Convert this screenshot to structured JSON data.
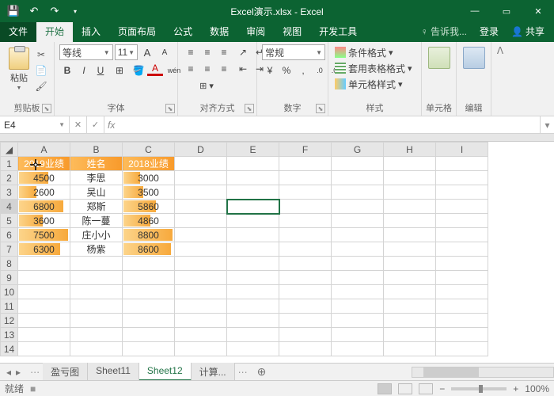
{
  "title": "Excel演示.xlsx - Excel",
  "qat": {
    "save": "💾",
    "undo": "↶",
    "redo": "↷",
    "more": "▾"
  },
  "win": {
    "min": "—",
    "max": "▭",
    "close": "✕"
  },
  "tabs": {
    "file": "文件",
    "home": "开始",
    "insert": "插入",
    "layout": "页面布局",
    "formulas": "公式",
    "data": "数据",
    "review": "审阅",
    "view": "视图",
    "dev": "开发工具"
  },
  "tellme": "♀ 告诉我...",
  "login": "登录",
  "share": "共享",
  "share_icon": "👤",
  "ribbon": {
    "clipboard": {
      "label": "剪贴板",
      "paste": "粘贴",
      "cut": "✂",
      "copy": "📄",
      "painter": "🖌"
    },
    "font": {
      "label": "字体",
      "name": "等线",
      "size": "11",
      "inc": "A",
      "dec": "A",
      "b": "B",
      "i": "I",
      "u": "U",
      "border": "⊞",
      "fill": "🪣",
      "color": "A",
      "phon": "wén"
    },
    "align": {
      "label": "对齐方式"
    },
    "number": {
      "label": "数字",
      "cat": "常规",
      "cur": "¥",
      "pct": "%",
      "comma": ",",
      "inc": ".0",
      "dec": ".00"
    },
    "styles": {
      "label": "样式",
      "cond": "条件格式",
      "table": "套用表格格式",
      "cell": "单元格样式"
    },
    "cells": {
      "label": "单元格"
    },
    "editing": {
      "label": "编辑"
    },
    "collapse": "ᐱ"
  },
  "namebox": "E4",
  "fx": "fx",
  "sheet": {
    "cols": [
      "A",
      "B",
      "C",
      "D",
      "E",
      "F",
      "G",
      "H",
      "I"
    ],
    "headers": {
      "a": "2019业绩",
      "b": "姓名",
      "c": "2018业绩"
    },
    "rows": [
      {
        "a": "4500",
        "aw": 60,
        "b": "李思",
        "c": "3000",
        "cw": 34
      },
      {
        "a": "2600",
        "aw": 35,
        "b": "吴山",
        "c": "3500",
        "cw": 40
      },
      {
        "a": "6800",
        "aw": 90,
        "b": "郑斯",
        "c": "5860",
        "cw": 66
      },
      {
        "a": "3600",
        "aw": 48,
        "b": "陈一蔓",
        "c": "4860",
        "cw": 55
      },
      {
        "a": "7500",
        "aw": 100,
        "b": "庄小小",
        "c": "8800",
        "cw": 100
      },
      {
        "a": "6300",
        "aw": 84,
        "b": "杨紫",
        "c": "8600",
        "cw": 97
      }
    ]
  },
  "sheettabs": {
    "nav": [
      "◂",
      "▸"
    ],
    "tabs": [
      "盈亏图",
      "Sheet11",
      "Sheet12",
      "计算..."
    ],
    "active": 2,
    "add": "⊕",
    "more": "⋯"
  },
  "status": {
    "ready": "就绪",
    "rec": "■",
    "zoom": "100%",
    "minus": "−",
    "plus": "+"
  }
}
